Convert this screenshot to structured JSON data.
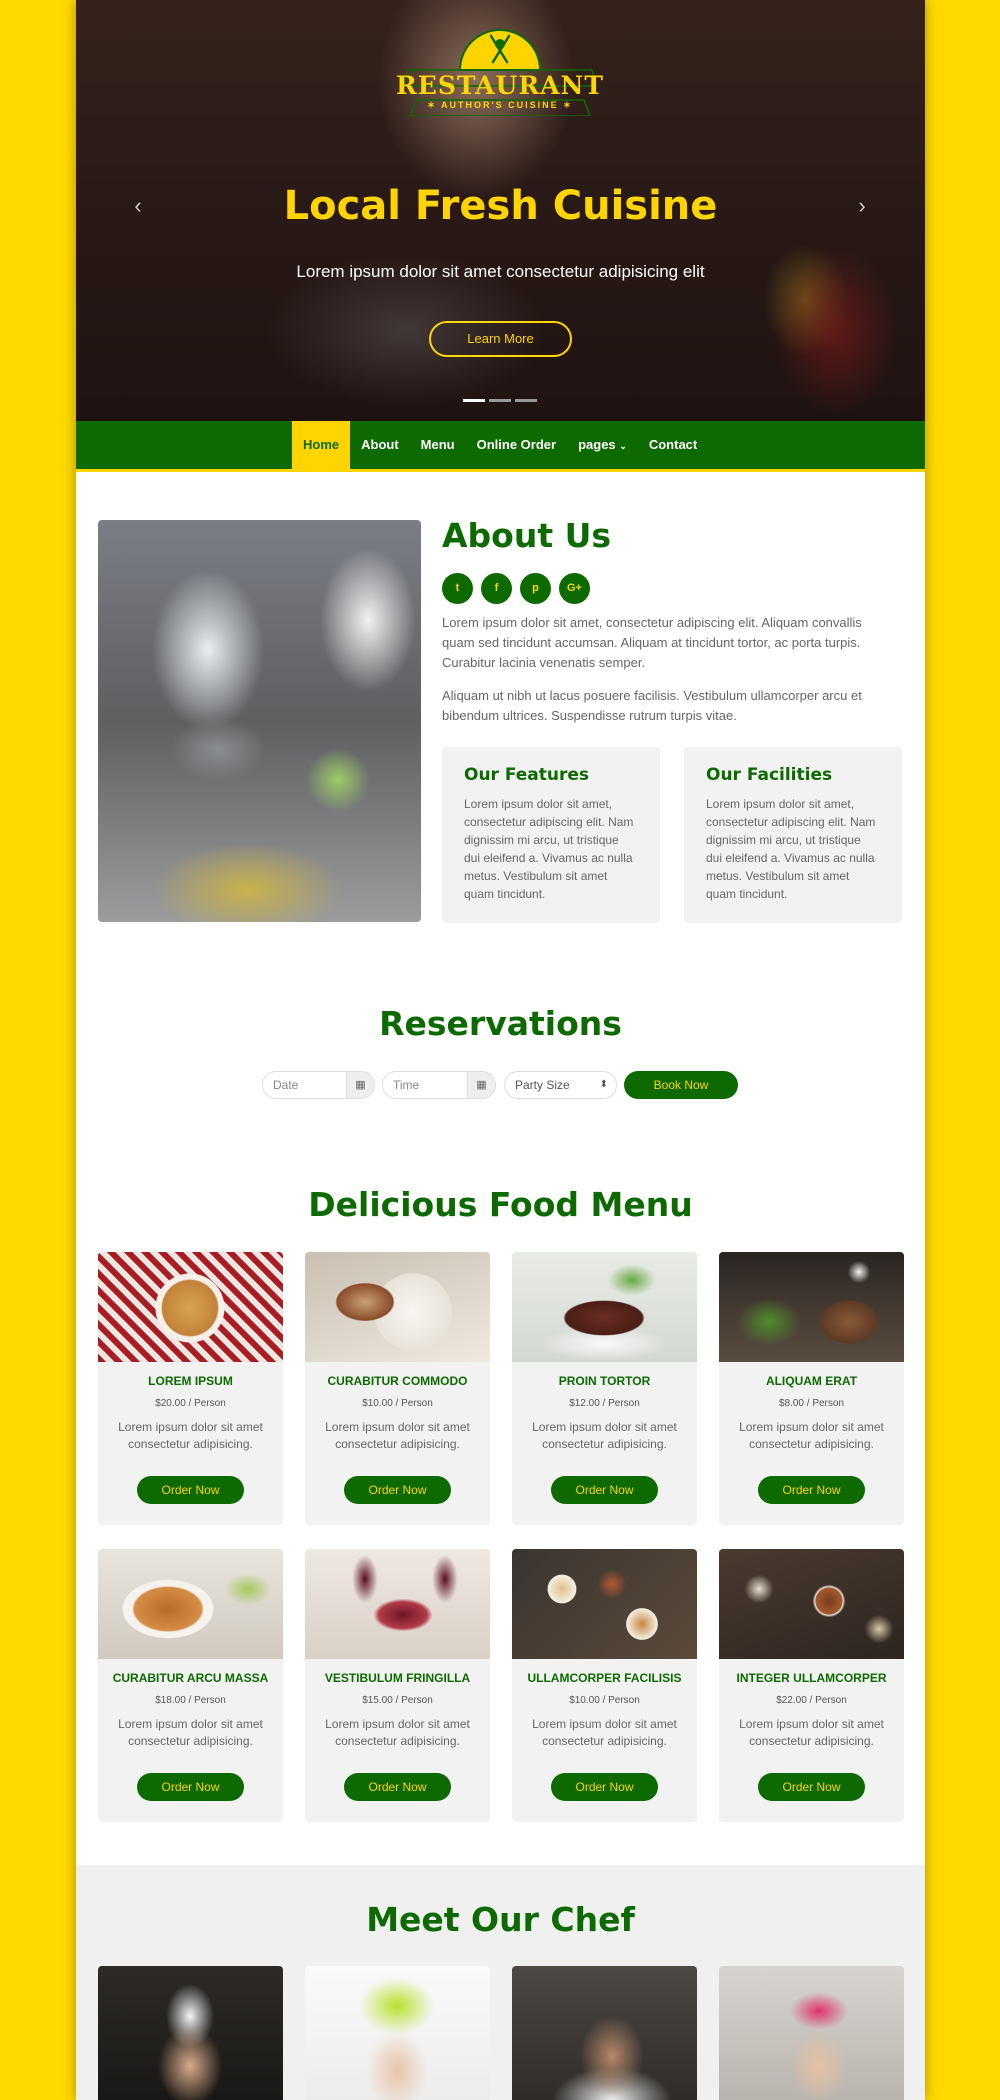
{
  "brand": {
    "name": "RESTAURANT",
    "tagline": "AUTHOR'S CUISINE"
  },
  "hero": {
    "title": "Local Fresh Cuisine",
    "subtitle": "Lorem ipsum dolor sit amet consectetur adipisicing elit",
    "button": "Learn More",
    "slide_count": 3,
    "active_slide": 1
  },
  "nav": {
    "items": [
      "Home",
      "About",
      "Menu",
      "Online Order",
      "pages",
      "Contact"
    ],
    "active": "Home"
  },
  "about": {
    "title": "About Us",
    "socials": [
      "twitter-icon",
      "facebook-icon",
      "pinterest-icon",
      "google-plus-icon"
    ],
    "p1": "Lorem ipsum dolor sit amet, consectetur adipiscing elit. Aliquam convallis quam sed tincidunt accumsan. Aliquam at tincidunt tortor, ac porta turpis. Curabitur lacinia venenatis semper.",
    "p2": "Aliquam ut nibh ut lacus posuere facilisis. Vestibulum ullamcorper arcu et bibendum ultrices. Suspendisse rutrum turpis vitae.",
    "features": {
      "title": "Our Features",
      "text": "Lorem ipsum dolor sit amet, consectetur adipiscing elit. Nam dignissim mi arcu, ut tristique dui eleifend a. Vivamus ac nulla metus. Vestibulum sit amet quam tincidunt."
    },
    "facilities": {
      "title": "Our Facilities",
      "text": "Lorem ipsum dolor sit amet, consectetur adipiscing elit. Nam dignissim mi arcu, ut tristique dui eleifend a. Vivamus ac nulla metus. Vestibulum sit amet quam tincidunt."
    }
  },
  "reservations": {
    "title": "Reservations",
    "date_placeholder": "Date",
    "time_placeholder": "Time",
    "party_size": "Party Size",
    "button": "Book Now"
  },
  "menu": {
    "title": "Delicious Food Menu",
    "order_label": "Order Now",
    "items": [
      {
        "name": "LOREM IPSUM",
        "price": "$20.00 / Person",
        "desc": "Lorem ipsum dolor sit amet consectetur adipisicing."
      },
      {
        "name": "CURABITUR COMMODO",
        "price": "$10.00 / Person",
        "desc": "Lorem ipsum dolor sit amet consectetur adipisicing."
      },
      {
        "name": "PROIN TORTOR",
        "price": "$12.00 / Person",
        "desc": "Lorem ipsum dolor sit amet consectetur adipisicing."
      },
      {
        "name": "ALIQUAM ERAT",
        "price": "$8.00 / Person",
        "desc": "Lorem ipsum dolor sit amet consectetur adipisicing."
      },
      {
        "name": "CURABITUR ARCU MASSA",
        "price": "$18.00 / Person",
        "desc": "Lorem ipsum dolor sit amet consectetur adipisicing."
      },
      {
        "name": "VESTIBULUM FRINGILLA",
        "price": "$15.00 / Person",
        "desc": "Lorem ipsum dolor sit amet consectetur adipisicing."
      },
      {
        "name": "ULLAMCORPER FACILISIS",
        "price": "$10.00 / Person",
        "desc": "Lorem ipsum dolor sit amet consectetur adipisicing."
      },
      {
        "name": "INTEGER ULLAMCORPER",
        "price": "$22.00 / Person",
        "desc": "Lorem ipsum dolor sit amet consectetur adipisicing."
      }
    ]
  },
  "chefs": {
    "title": "Meet Our Chef"
  },
  "colors": {
    "brand_green": "#0c6a00",
    "accent_yellow": "#ffd400",
    "page_bg": "#ffd900"
  }
}
